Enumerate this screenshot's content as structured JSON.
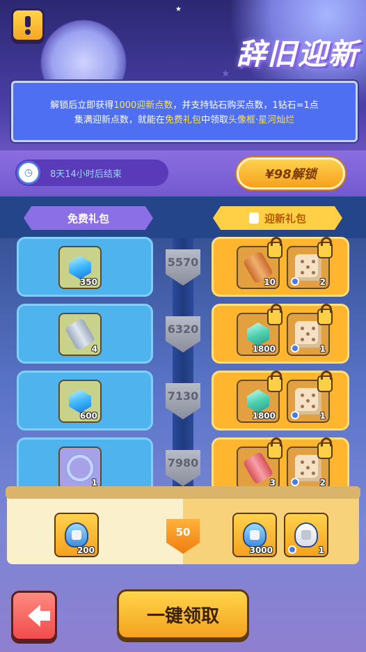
{
  "header": {
    "title": "辞旧迎新",
    "help_icon": "exclamation-icon"
  },
  "info": {
    "line1": {
      "pre": "解锁后立即获得",
      "points": "1000迎新点数",
      "post": "，并支持钻石购买点数，1钻石=1点"
    },
    "line2": {
      "pre": "集满迎新点数，就能在",
      "gift": "免费礼包",
      "mid": "中领取",
      "reward": "头像框·星河灿烂"
    }
  },
  "timer": {
    "text": "8天14小时后结束"
  },
  "unlock_button": {
    "label": "¥98解锁"
  },
  "tabs": {
    "free": "免费礼包",
    "new": "迎新礼包"
  },
  "rows": [
    {
      "points": "5570",
      "free": {
        "icon": "blue-gem-icon",
        "qty": "350"
      },
      "paid": [
        {
          "icon": "orange-scroll-icon",
          "qty": "10"
        },
        {
          "icon": "dice-icon",
          "qty": "2"
        }
      ]
    },
    {
      "points": "6320",
      "free": {
        "icon": "silver-scroll-icon",
        "qty": "4"
      },
      "paid": [
        {
          "icon": "green-gem-icon",
          "qty": "1800"
        },
        {
          "icon": "dice-icon",
          "qty": "1"
        }
      ]
    },
    {
      "points": "7130",
      "free": {
        "icon": "blue-gem-icon",
        "qty": "600"
      },
      "paid": [
        {
          "icon": "green-gem-icon",
          "qty": "1800"
        },
        {
          "icon": "dice-icon",
          "qty": "1"
        }
      ]
    },
    {
      "points": "7980",
      "free": {
        "icon": "avatar-frame-ring-icon",
        "qty": "1"
      },
      "paid": [
        {
          "icon": "pink-scroll-icon",
          "qty": "3"
        },
        {
          "icon": "dice-icon",
          "qty": "2"
        }
      ]
    }
  ],
  "bottom": {
    "free_item_qty": "200",
    "level": "50",
    "paid_items": [
      {
        "qty": "3000"
      },
      {
        "qty": "1"
      }
    ]
  },
  "footer": {
    "back_icon": "arrow-left-icon",
    "claim_all": "一键领取"
  },
  "colors": {
    "gold": "#ffcf45",
    "blue_card": "#4fb3ee",
    "orange_card": "#ffb52e",
    "highlight_text": "#ffe34a"
  }
}
